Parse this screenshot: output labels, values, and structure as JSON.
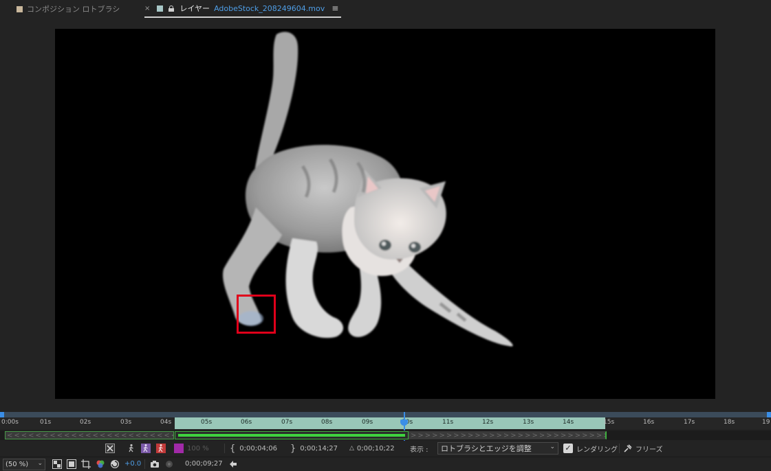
{
  "tabs": {
    "composition": {
      "label": "コンポジション ロトブラシ",
      "color": "#c9b79c"
    },
    "layer": {
      "close": "×",
      "prefix": "レイヤー",
      "file": "AdobeStock_208249604.mov",
      "menu": "≡",
      "color": "#a7c7c7"
    }
  },
  "viewer": {
    "background": "#000000",
    "roto_box_color": "#e0001a"
  },
  "timeline": {
    "ticks": [
      "0:00s",
      "01s",
      "02s",
      "03s",
      "04s",
      "05s",
      "06s",
      "07s",
      "08s",
      "09s",
      "10s",
      "11s",
      "12s",
      "13s",
      "14s",
      "15s",
      "16s",
      "17s",
      "18s",
      "19"
    ],
    "work_area_color": "#99c7b8",
    "playhead_color": "#3a8ee6",
    "span_color": "#3fd33f"
  },
  "controls": {
    "opacity": "100 %",
    "in_point": "0;00;04;06",
    "out_point": "0;00;14;27",
    "duration_symbol": "△",
    "duration": "0;00;10;22",
    "view_label": "表示 :",
    "view_value": "ロトブラシとエッジを調整",
    "render_label": "レンダリング",
    "freeze_label": "フリーズ"
  },
  "status": {
    "zoom": "(50 %)",
    "exposure": "+0.0",
    "current_time": "0;00;09;27"
  }
}
